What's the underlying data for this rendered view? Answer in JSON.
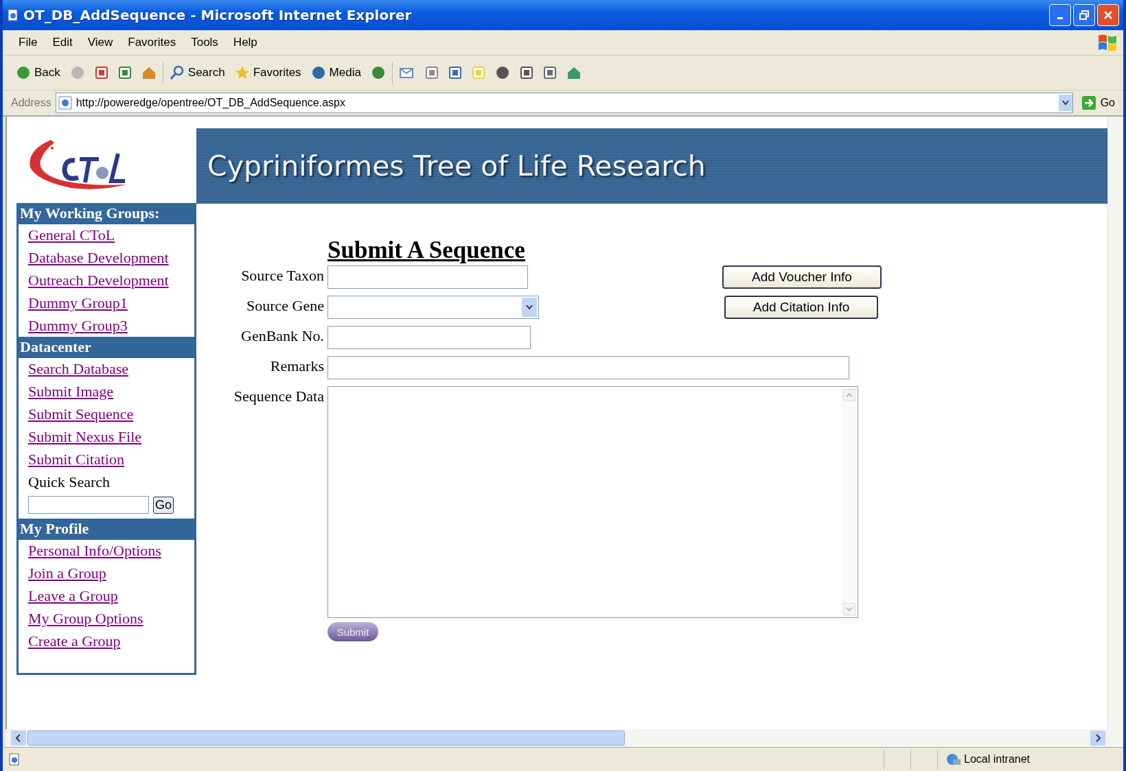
{
  "window": {
    "title": "OT_DB_AddSequence - Microsoft Internet Explorer"
  },
  "menu": [
    "File",
    "Edit",
    "View",
    "Favorites",
    "Tools",
    "Help"
  ],
  "toolbar": [
    {
      "kind": "back",
      "label": "Back"
    },
    {
      "kind": "forward"
    },
    {
      "kind": "stop"
    },
    {
      "kind": "refresh"
    },
    {
      "kind": "home"
    },
    {
      "kind": "search",
      "label": "Search"
    },
    {
      "kind": "favorites",
      "label": "Favorites"
    },
    {
      "kind": "media",
      "label": "Media"
    },
    {
      "kind": "history"
    },
    {
      "kind": "mail"
    },
    {
      "kind": "print"
    },
    {
      "kind": "edit"
    },
    {
      "kind": "note"
    },
    {
      "kind": "block"
    },
    {
      "kind": "page"
    },
    {
      "kind": "research"
    },
    {
      "kind": "messenger"
    }
  ],
  "address_bar": {
    "label": "Address",
    "url": "http://poweredge/opentree/OT_DB_AddSequence.aspx",
    "go": "Go"
  },
  "banner": {
    "title": "Cypriniformes Tree of Life Research"
  },
  "sidebar": [
    {
      "heading": "My Working Groups:",
      "links": [
        "General CToL",
        "Database Development",
        "Outreach Development",
        "Dummy Group1",
        "Dummy Group3"
      ]
    },
    {
      "heading": "Datacenter",
      "links": [
        "Search Database",
        "Submit Image",
        "Submit Sequence",
        "Submit Nexus File",
        "Submit Citation"
      ],
      "quick_search": {
        "label": "Quick Search",
        "button": "Go"
      }
    },
    {
      "heading": "My Profile",
      "links": [
        "Personal Info/Options",
        "Join a Group",
        "Leave a Group",
        "My Group Options",
        "Create a Group"
      ]
    }
  ],
  "form": {
    "title": "Submit A Sequence",
    "fields": [
      {
        "label": "Source Taxon",
        "kind": "text"
      },
      {
        "label": "Source Gene",
        "kind": "select"
      },
      {
        "label": "GenBank No.",
        "kind": "text"
      },
      {
        "label": "Remarks",
        "kind": "wide"
      },
      {
        "label": "Sequence Data",
        "kind": "textarea"
      }
    ],
    "side_buttons": [
      "Add Voucher Info",
      "Add Citation Info"
    ],
    "submit": "Submit"
  },
  "status_bar": {
    "zone": "Local intranet"
  }
}
